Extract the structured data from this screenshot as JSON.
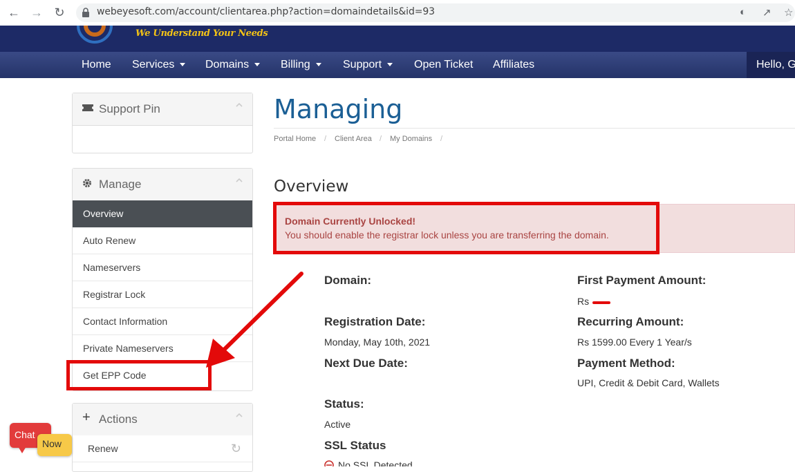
{
  "browser": {
    "url": "webeyesoft.com/account/clientarea.php?action=domaindetails&id=93"
  },
  "site": {
    "tagline": "We Understand Your Needs",
    "nav": [
      "Home",
      "Services",
      "Domains",
      "Billing",
      "Support",
      "Open Ticket",
      "Affiliates"
    ],
    "greeting": "Hello, Ga"
  },
  "sidebar": {
    "support_pin": {
      "title": "Support Pin"
    },
    "manage": {
      "title": "Manage",
      "items": [
        "Overview",
        "Auto Renew",
        "Nameservers",
        "Registrar Lock",
        "Contact Information",
        "Private Nameservers",
        "Get EPP Code"
      ],
      "active_index": 0
    },
    "actions": {
      "title": "Actions",
      "items": [
        "Renew"
      ]
    }
  },
  "main": {
    "title": "Managing",
    "breadcrumb": [
      "Portal Home",
      "Client Area",
      "My Domains"
    ],
    "overview_heading": "Overview",
    "alert": {
      "title": "Domain Currently Unlocked!",
      "text": "You should enable the registrar lock unless you are transferring the domain."
    },
    "fields_left": {
      "domain_label": "Domain:",
      "registration_label": "Registration Date:",
      "registration_value": "Monday, May 10th, 2021",
      "next_due_label": "Next Due Date:",
      "status_label": "Status:",
      "status_value": "Active",
      "ssl_label": "SSL Status",
      "ssl_value": "No SSL Detected"
    },
    "fields_right": {
      "first_payment_label": "First Payment Amount:",
      "first_payment_value": "Rs",
      "recurring_label": "Recurring Amount:",
      "recurring_value": "Rs 1599.00 Every 1 Year/s",
      "payment_method_label": "Payment Method:",
      "payment_method_value": "UPI, Credit & Debit Card, Wallets"
    }
  },
  "chat": {
    "chat_label": "Chat",
    "now_label": "Now"
  },
  "colors": {
    "header_navy": "#1d2a66",
    "title_blue": "#1b5f95",
    "alert_bg": "#f2dede",
    "alert_text": "#a94442",
    "annotation_red": "#e30a0a",
    "tagline_gold": "#f3c316"
  },
  "icons": [
    "back-arrow-icon",
    "forward-arrow-icon",
    "reload-icon",
    "lock-icon",
    "eye-off-icon",
    "share-icon",
    "star-icon",
    "ticket-icon",
    "gear-icon",
    "plus-icon",
    "refresh-icon",
    "chevron-up-icon"
  ]
}
